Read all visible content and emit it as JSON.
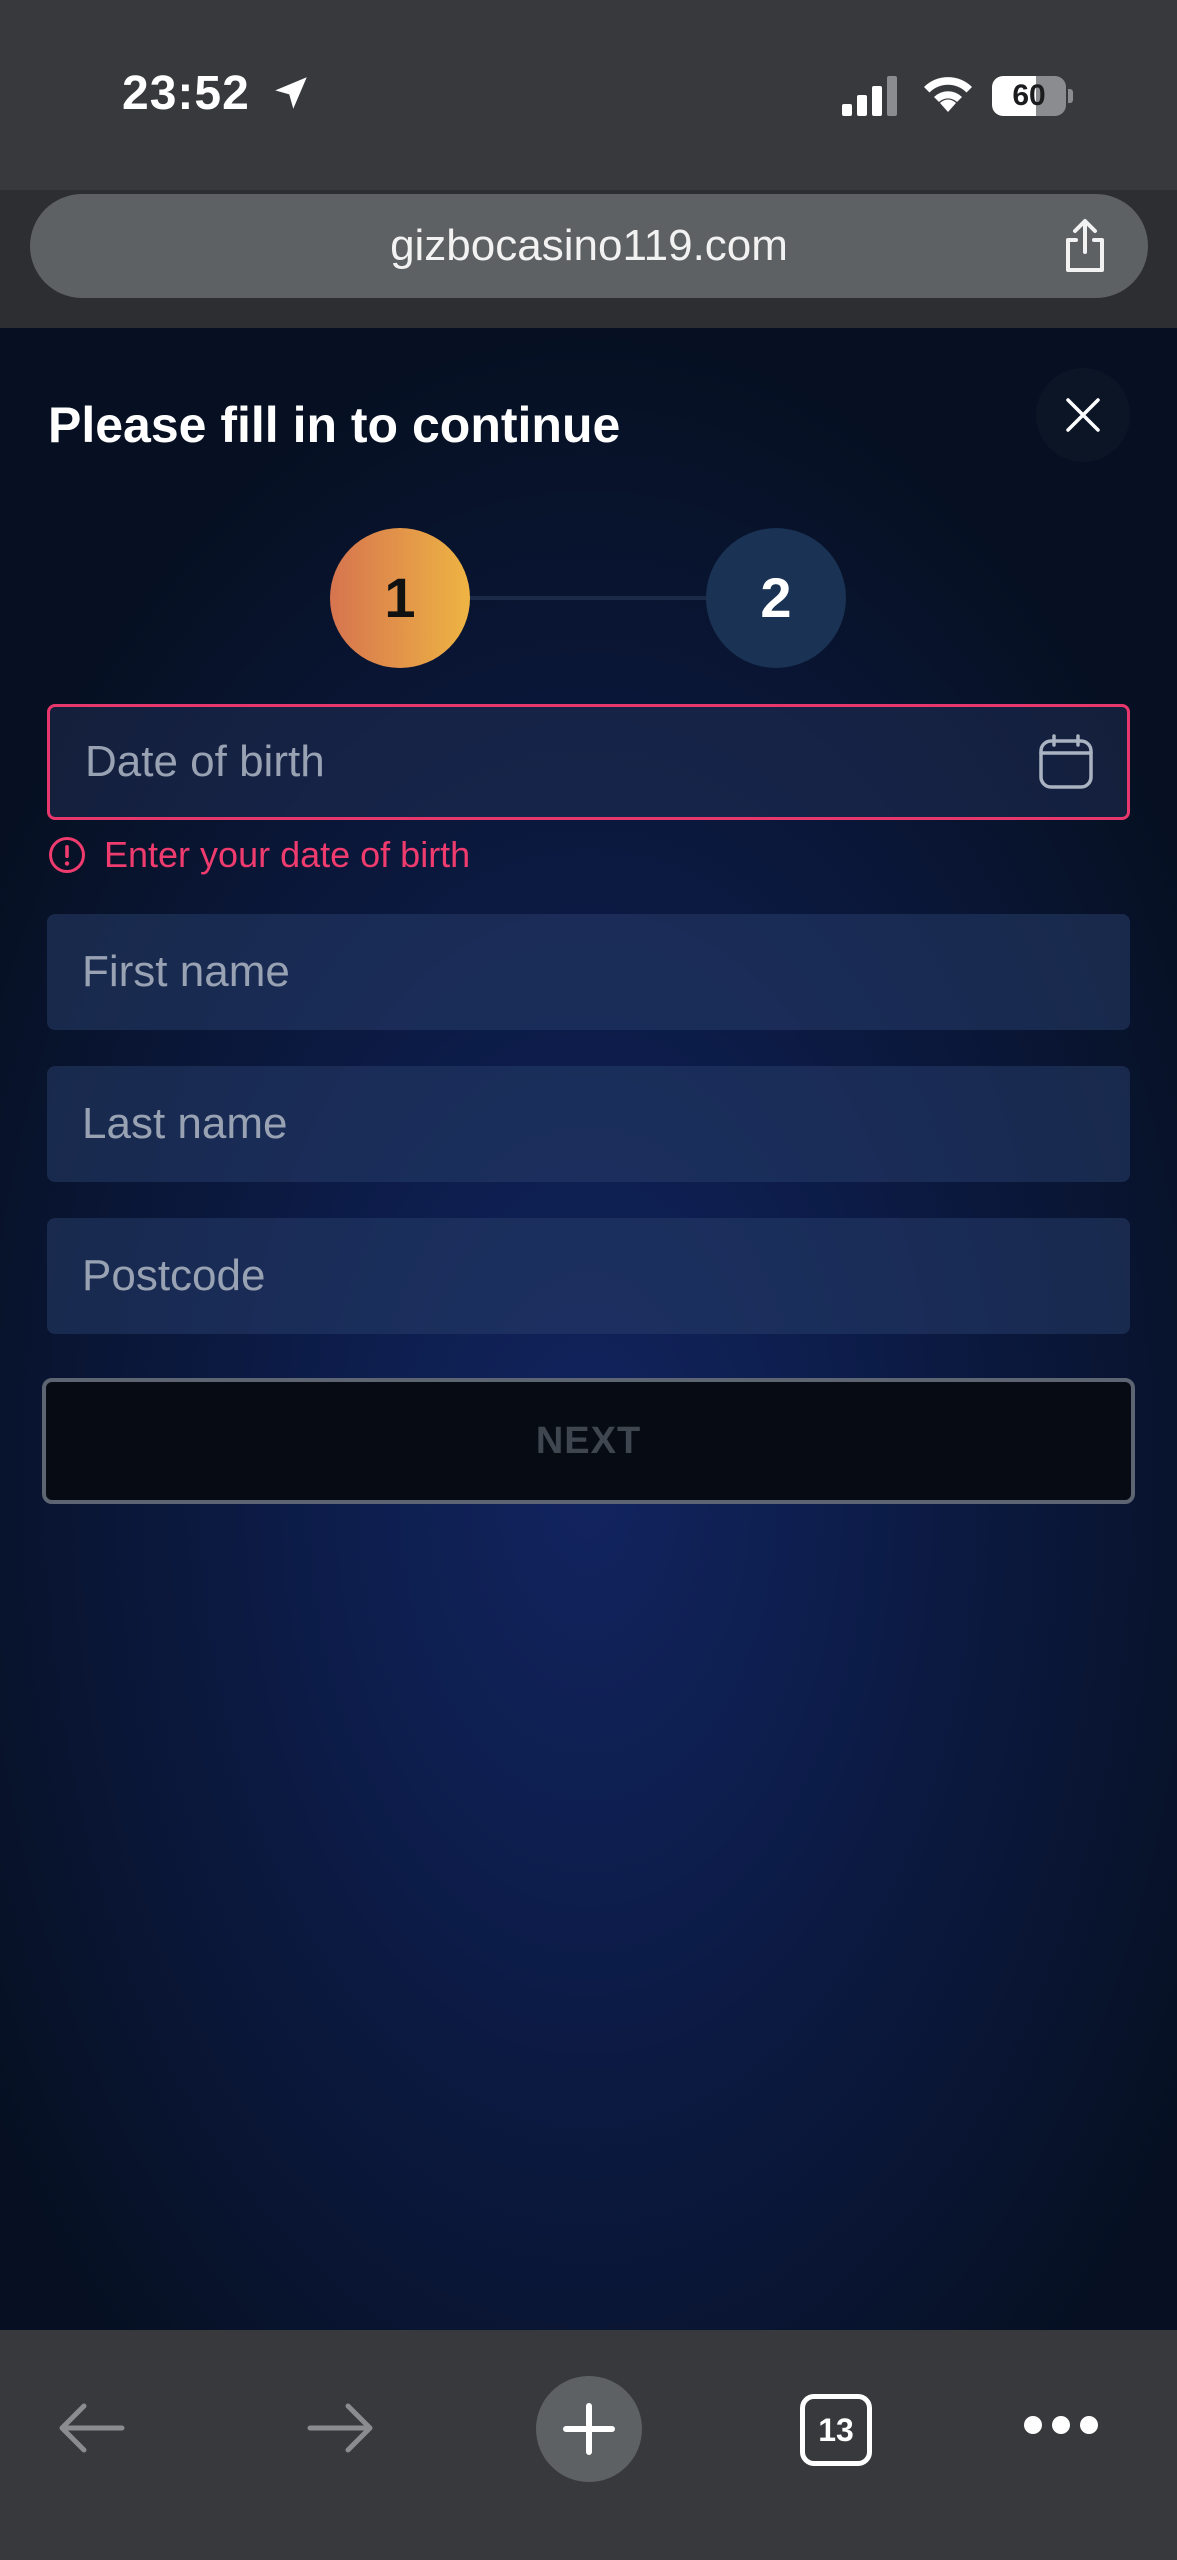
{
  "status_bar": {
    "time": "23:52",
    "battery_level": "60",
    "battery_fraction": 0.6,
    "icons": [
      "location-arrow-icon",
      "cellular-signal-icon",
      "wifi-icon",
      "battery-icon"
    ]
  },
  "browser": {
    "url": "gizbocasino119.com",
    "share_icon": "share-icon"
  },
  "form": {
    "title": "Please fill in to continue",
    "steps": [
      {
        "label": "1",
        "state": "active"
      },
      {
        "label": "2",
        "state": "inactive"
      }
    ],
    "fields": {
      "dob": {
        "value": "",
        "placeholder": "Date of birth",
        "error": "Enter your date of birth"
      },
      "first_name": {
        "value": "",
        "placeholder": "First name"
      },
      "last_name": {
        "value": "",
        "placeholder": "Last name"
      },
      "postcode": {
        "value": "",
        "placeholder": "Postcode"
      }
    },
    "next_label": "NEXT"
  },
  "toolbar": {
    "tab_count": "13",
    "buttons": [
      "back-arrow-icon",
      "forward-arrow-icon",
      "plus-icon",
      "tabs-icon",
      "more-icon"
    ]
  },
  "colors": {
    "accent_gradient_start": "#d6744f",
    "accent_gradient_end": "#eeb443",
    "error": "#ef3b6e",
    "page_background": "#0d1d4c",
    "field_background": "#1e3160"
  }
}
